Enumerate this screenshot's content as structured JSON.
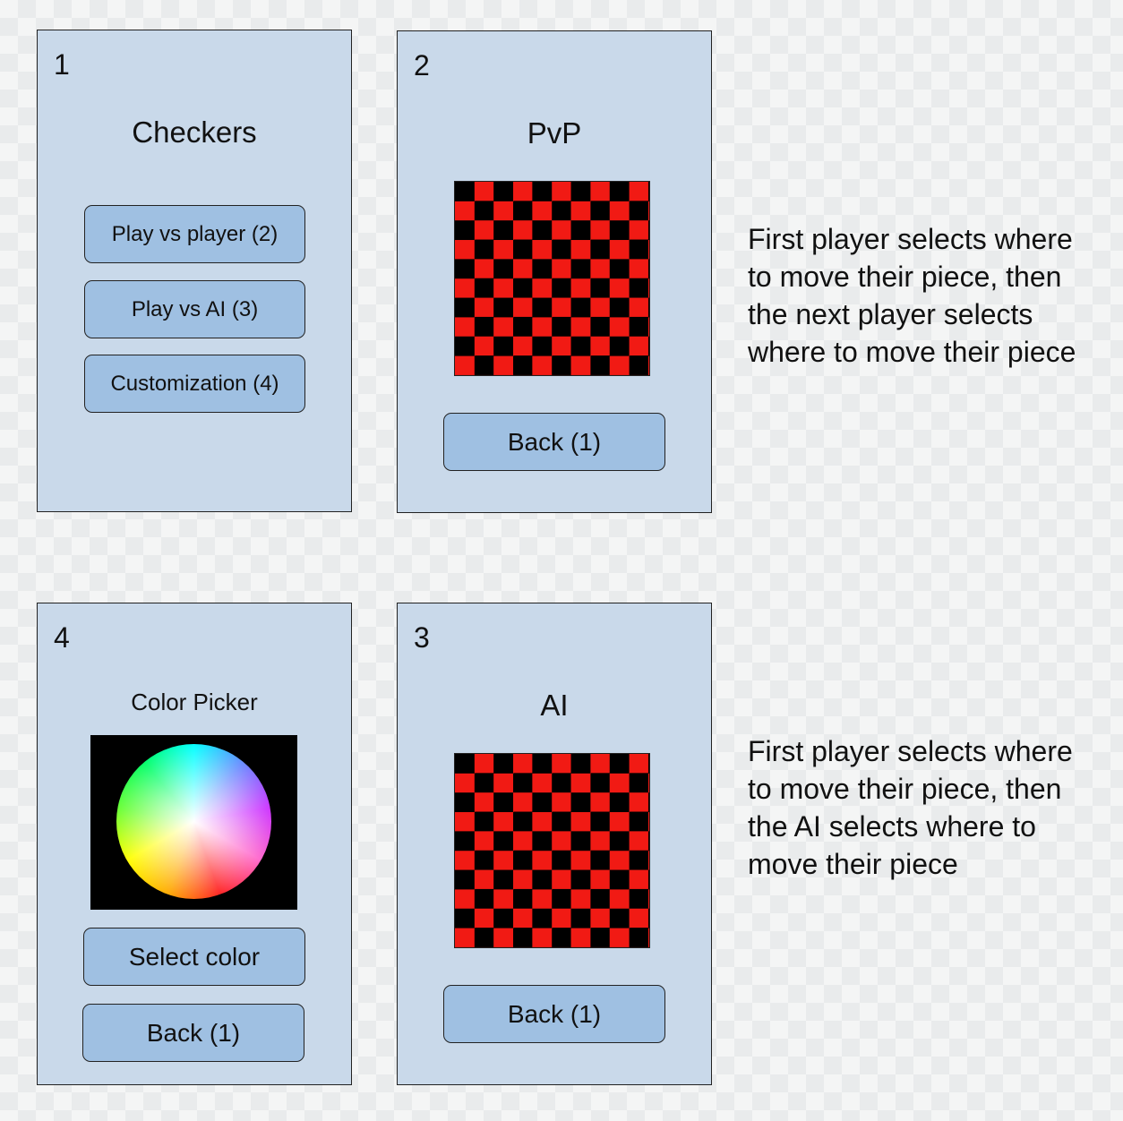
{
  "screens": {
    "menu": {
      "number": "1",
      "title": "Checkers",
      "buttons": {
        "pvp": "Play vs player (2)",
        "ai": "Play vs AI (3)",
        "custom": "Customization (4)"
      }
    },
    "pvp": {
      "number": "2",
      "title": "PvP",
      "back_label": "Back (1)",
      "board_colors": [
        "#f11a14",
        "#000000"
      ]
    },
    "custom": {
      "number": "4",
      "title": "Color Picker",
      "select_label": "Select color",
      "back_label": "Back (1)"
    },
    "ai": {
      "number": "3",
      "title": "AI",
      "back_label": "Back (1)",
      "board_colors": [
        "#f11a14",
        "#000000"
      ]
    }
  },
  "descriptions": {
    "pvp": "First player selects where to move their piece, then the next player selects where to move their piece",
    "ai": "First player selects where to move their piece, then the AI selects where to move their piece"
  },
  "colors": {
    "screen_bg": "#c9d9ea",
    "button_bg": "#9fc0e2"
  }
}
